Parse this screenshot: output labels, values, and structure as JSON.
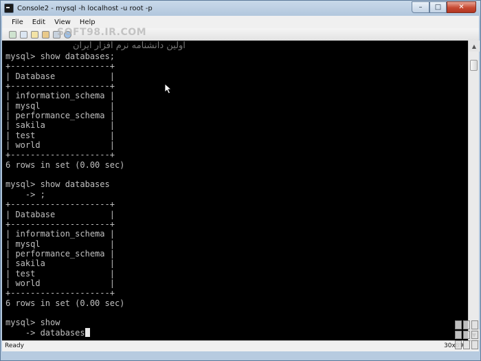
{
  "window": {
    "title": "Console2 - mysql  -h localhost -u root -p",
    "minimize_glyph": "–",
    "maximize_glyph": "□",
    "close_glyph": "✕"
  },
  "menu": {
    "file": "File",
    "edit": "Edit",
    "view": "View",
    "help": "Help"
  },
  "toolbar_icons": [
    "new-tab-icon",
    "pause-icon",
    "copy-icon",
    "paste-icon",
    "settings-icon",
    "help-icon"
  ],
  "watermark": {
    "site": "SOFT98.IR.COM",
    "persian": "اولین دانشنامه نرم افزار ایران"
  },
  "console": {
    "lines": [
      "mysql> show databases;",
      "+--------------------+",
      "| Database           |",
      "+--------------------+",
      "| information_schema |",
      "| mysql              |",
      "| performance_schema |",
      "| sakila             |",
      "| test               |",
      "| world              |",
      "+--------------------+",
      "6 rows in set (0.00 sec)",
      "",
      "mysql> show databases",
      "    -> ;",
      "+--------------------+",
      "| Database           |",
      "+--------------------+",
      "| information_schema |",
      "| mysql              |",
      "| performance_schema |",
      "| sakila             |",
      "| test               |",
      "| world              |",
      "+--------------------+",
      "6 rows in set (0.00 sec)",
      "",
      "mysql> show",
      "    -> databases"
    ]
  },
  "status": {
    "text": "Ready",
    "size": "30x89"
  }
}
